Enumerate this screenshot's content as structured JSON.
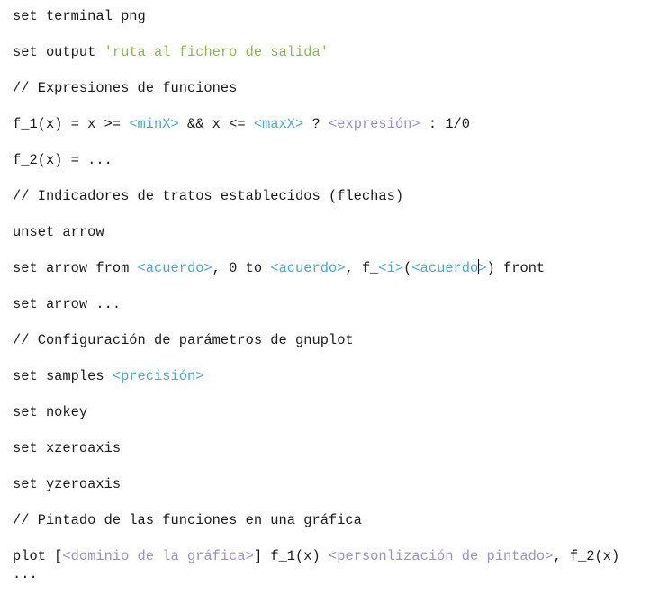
{
  "lines": [
    [
      {
        "t": "set terminal png",
        "c": ""
      }
    ],
    [
      {
        "t": "set output ",
        "c": ""
      },
      {
        "t": "'ruta al fichero de salida'",
        "c": "str"
      }
    ],
    [
      {
        "t": "// Expresiones de funciones",
        "c": ""
      }
    ],
    [
      {
        "t": "f_1(x) = x >= ",
        "c": ""
      },
      {
        "t": "<minX>",
        "c": "cy"
      },
      {
        "t": " && x <= ",
        "c": ""
      },
      {
        "t": "<maxX>",
        "c": "cy"
      },
      {
        "t": " ? ",
        "c": ""
      },
      {
        "t": "<expresión>",
        "c": "pu"
      },
      {
        "t": " : 1/0",
        "c": ""
      }
    ],
    [
      {
        "t": "f_2(x) = ...",
        "c": ""
      }
    ],
    [
      {
        "t": "// Indicadores de tratos establecidos (flechas)",
        "c": ""
      }
    ],
    [
      {
        "t": "unset arrow",
        "c": ""
      }
    ],
    [
      {
        "t": "set arrow from ",
        "c": ""
      },
      {
        "t": "<acuerdo>",
        "c": "cy"
      },
      {
        "t": ", 0 to ",
        "c": ""
      },
      {
        "t": "<acuerdo>",
        "c": "cy"
      },
      {
        "t": ", f_",
        "c": ""
      },
      {
        "t": "<i>",
        "c": "cy"
      },
      {
        "t": "(",
        "c": ""
      },
      {
        "t": "<acuerdo",
        "c": "cy"
      },
      {
        "t": "",
        "c": "caret"
      },
      {
        "t": ">",
        "c": "cy"
      },
      {
        "t": ") front",
        "c": ""
      }
    ],
    [
      {
        "t": "set arrow ...",
        "c": ""
      }
    ],
    [
      {
        "t": "// Configuración de parámetros de gnuplot",
        "c": ""
      }
    ],
    [
      {
        "t": "set samples ",
        "c": ""
      },
      {
        "t": "<precisión>",
        "c": "cy"
      }
    ],
    [
      {
        "t": "set nokey",
        "c": ""
      }
    ],
    [
      {
        "t": "set xzeroaxis",
        "c": ""
      }
    ],
    [
      {
        "t": "set yzeroaxis",
        "c": ""
      }
    ],
    [
      {
        "t": "// Pintado de las funciones en una gráfica",
        "c": ""
      }
    ],
    [
      {
        "t": "plot [",
        "c": ""
      },
      {
        "t": "<dominio de la gráfica>",
        "c": "pu"
      },
      {
        "t": "] f_1(x) ",
        "c": ""
      },
      {
        "t": "<personlización de pintado>",
        "c": "pu"
      },
      {
        "t": ", f_2(x) ...",
        "c": ""
      }
    ]
  ]
}
